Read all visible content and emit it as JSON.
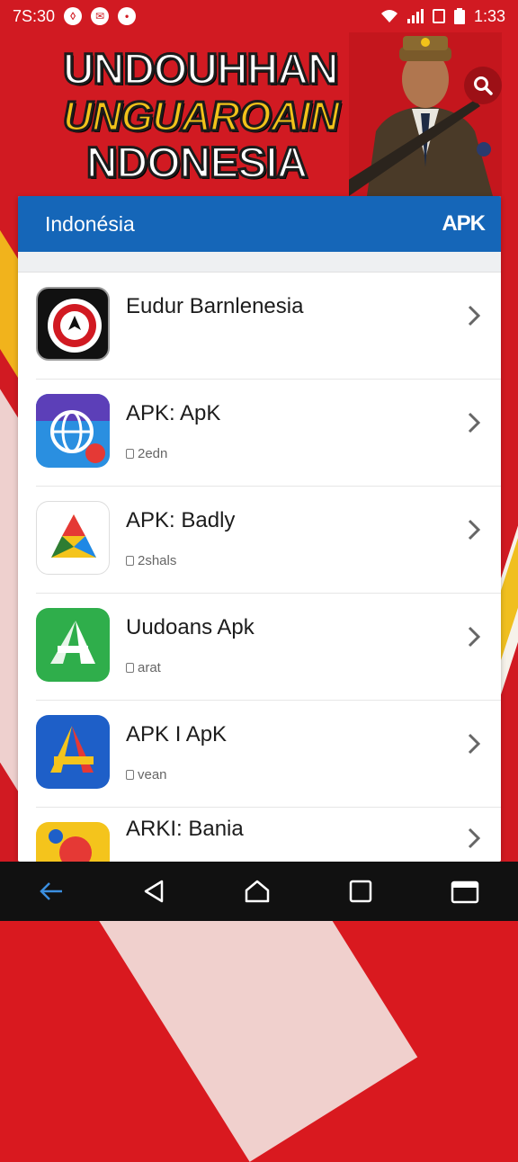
{
  "status_bar": {
    "time_left": "7S:30",
    "time_right": "1:33"
  },
  "hero": {
    "line1": "UNDOUHHAN",
    "line2": "UNGUAROAIN",
    "line3": "NDONESIA"
  },
  "card": {
    "title": "Indonésia",
    "badge": "APK"
  },
  "apps": [
    {
      "name": "Eudur Barnlenesia",
      "meta": ""
    },
    {
      "name": "APK: ApK",
      "meta": "2edn"
    },
    {
      "name": "APK: Badly",
      "meta": "2shals"
    },
    {
      "name": "Uudoans Apk",
      "meta": "arat"
    },
    {
      "name": "APK I ApK",
      "meta": "vean"
    },
    {
      "name": "ARKI: Bania",
      "meta": ""
    }
  ],
  "colors": {
    "brand_red": "#d11a22",
    "header_blue": "#1566b8",
    "accent_yellow": "#f2c21a"
  }
}
